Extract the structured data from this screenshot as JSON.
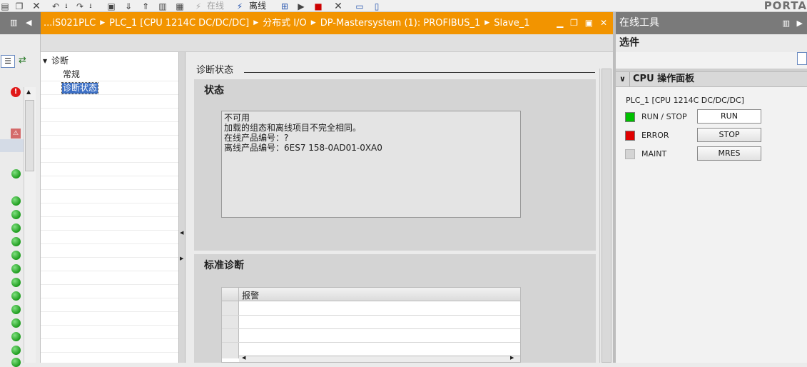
{
  "toolbar": {
    "online_label": "在线",
    "offline_label": "离线",
    "portal_label": "PORTA"
  },
  "editor": {
    "breadcrumb": [
      "...iS021PLC",
      "PLC_1 [CPU 1214C DC/DC/DC]",
      "分布式 I/O",
      "DP-Mastersystem (1): PROFIBUS_1",
      "Slave_1"
    ]
  },
  "nav": {
    "root": "诊断",
    "items": [
      "常规",
      "诊断状态"
    ],
    "selected": "诊断状态"
  },
  "content": {
    "title": "诊断状态",
    "status_panel_title": "状态",
    "status_lines": [
      "不可用",
      "加载的组态和离线项目不完全相同。",
      "在线产品编号：?",
      "离线产品编号：6ES7 158-0AD01-0XA0"
    ],
    "standard_panel_title": "标准诊断",
    "alarm_column": "报警"
  },
  "online_tools": {
    "title": "在线工具",
    "options_label": "选件",
    "cpu_panel_title": "CPU 操作面板",
    "cpu_name": "PLC_1 [CPU 1214C DC/DC/DC]",
    "leds": [
      {
        "label": "RUN / STOP",
        "color": "#00c000"
      },
      {
        "label": "ERROR",
        "color": "#e00000"
      },
      {
        "label": "MAINT",
        "color": "#d4d4d4"
      }
    ],
    "buttons": [
      "RUN",
      "STOP",
      "MRES"
    ]
  },
  "colors": {
    "title_bar": "#f29400",
    "selected_item": "#3c6fc4"
  }
}
